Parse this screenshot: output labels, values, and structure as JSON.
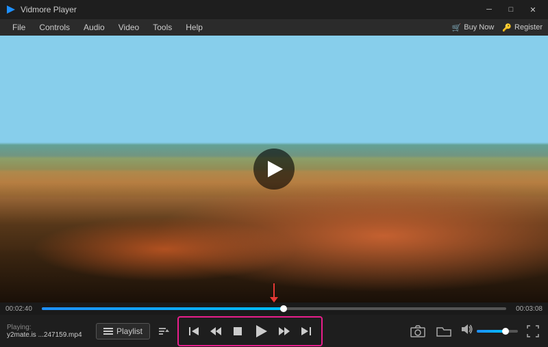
{
  "titlebar": {
    "title": "Vidmore Player",
    "logo": "▶",
    "min_btn": "─",
    "max_btn": "□",
    "close_btn": "✕"
  },
  "menubar": {
    "items": [
      "File",
      "Controls",
      "Audio",
      "Video",
      "Tools",
      "Help"
    ],
    "buy_btn": "Buy Now",
    "register_btn": "Register"
  },
  "player": {
    "time_current": "00:02:40",
    "time_total": "00:03:08"
  },
  "controls": {
    "playlist_label": "Playlist",
    "playing_label": "Playing:",
    "filename": "y2mate.is ...247159.mp4",
    "skip_prev": "⏮",
    "rewind": "⏪",
    "stop": "⏹",
    "play": "▶",
    "forward": "⏩",
    "skip_next": "⏭"
  }
}
